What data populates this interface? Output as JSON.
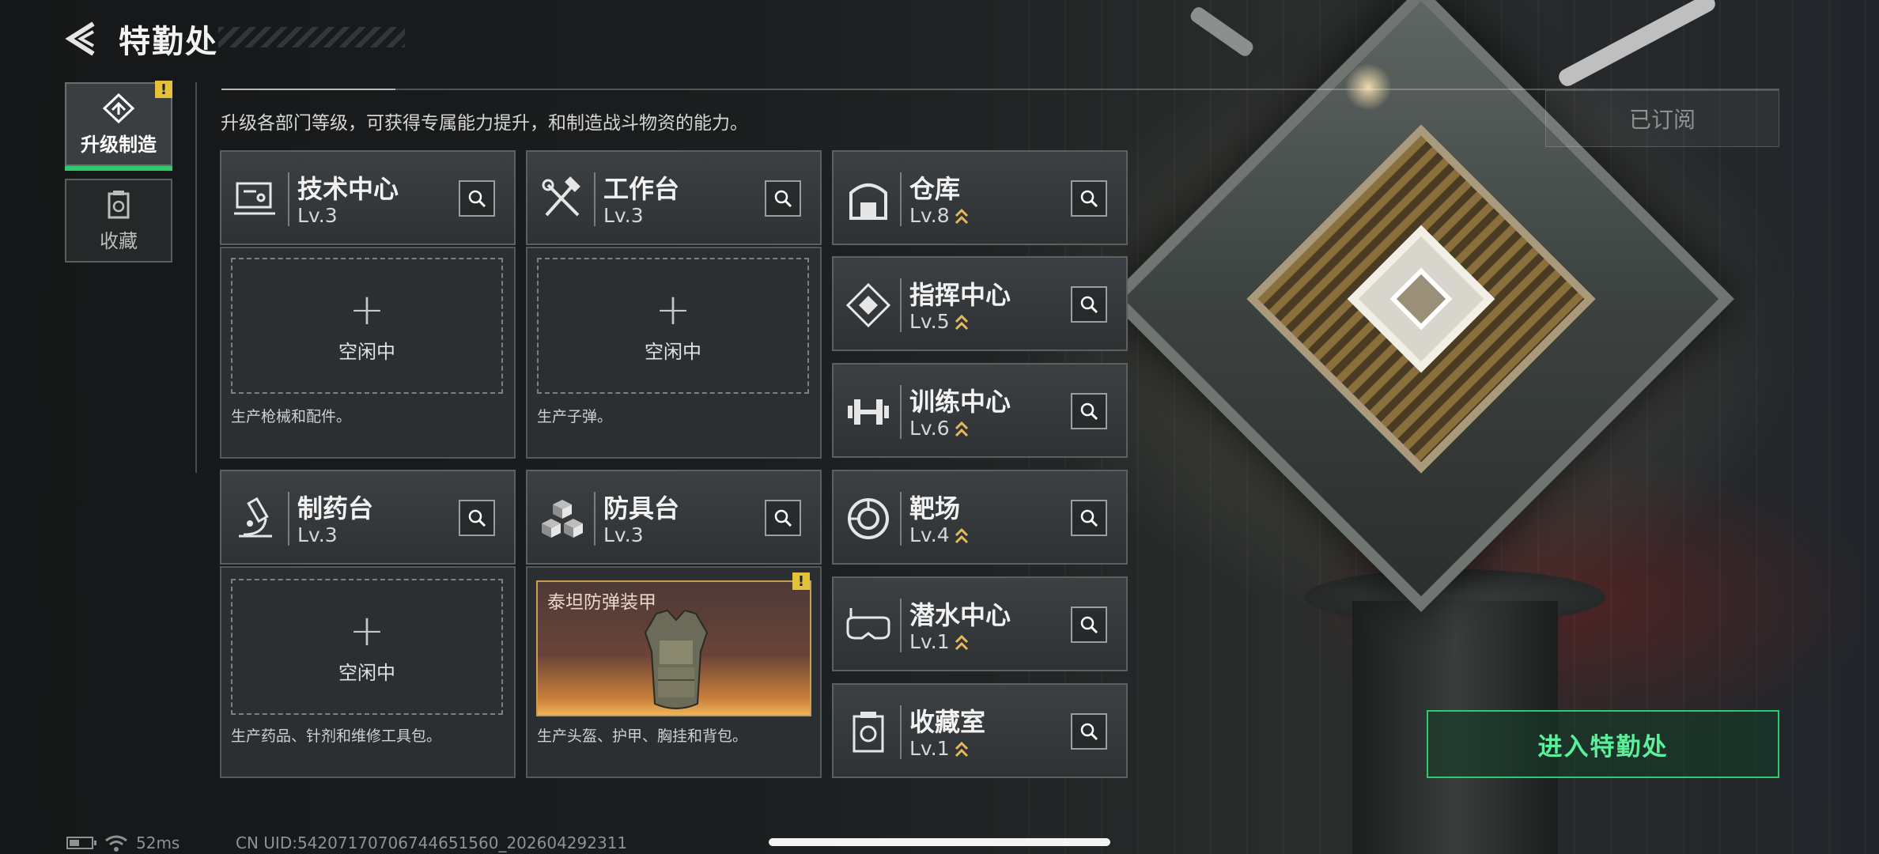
{
  "header": {
    "title": "特勤处",
    "subtitle": "升级各部门等级，可获得专属能力提升，和制造战斗物资的能力。",
    "subscribed_label": "已订阅"
  },
  "tabs": [
    {
      "label": "升级制造",
      "icon": "upgrade-icon",
      "active": true,
      "alert": "!"
    },
    {
      "label": "收藏",
      "icon": "collection-icon",
      "active": false
    }
  ],
  "production": [
    {
      "name": "技术中心",
      "level": "Lv.3",
      "icon": "circuit-icon",
      "slot": "空闲中",
      "desc": "生产枪械和配件。"
    },
    {
      "name": "工作台",
      "level": "Lv.3",
      "icon": "tools-icon",
      "slot": "空闲中",
      "desc": "生产子弹。"
    },
    {
      "name": "制药台",
      "level": "Lv.3",
      "icon": "microscope-icon",
      "slot": "空闲中",
      "desc": "生产药品、针剂和维修工具包。"
    },
    {
      "name": "防具台",
      "level": "Lv.3",
      "icon": "cubes-icon",
      "item": "泰坦防弹装甲",
      "alert": "!",
      "desc": "生产头盔、护甲、胸挂和背包。"
    }
  ],
  "facilities": [
    {
      "name": "仓库",
      "level": "Lv.8",
      "icon": "warehouse-icon",
      "upgradable": true
    },
    {
      "name": "指挥中心",
      "level": "Lv.5",
      "icon": "command-icon",
      "upgradable": true
    },
    {
      "name": "训练中心",
      "level": "Lv.6",
      "icon": "dumbbell-icon",
      "upgradable": true
    },
    {
      "name": "靶场",
      "level": "Lv.4",
      "icon": "target-icon",
      "upgradable": true
    },
    {
      "name": "潜水中心",
      "level": "Lv.1",
      "icon": "diving-mask-icon",
      "upgradable": true
    },
    {
      "name": "收藏室",
      "level": "Lv.1",
      "icon": "collection-room-icon",
      "upgradable": true
    }
  ],
  "enter_button": "进入特勤处",
  "status": {
    "ping": "52ms",
    "uid": "CN UID:5420717070674465156​0_202604292311"
  },
  "colors": {
    "accent_green": "#2ecb6c",
    "alert_yellow": "#e3c23a",
    "upgrade_gold": "#e7b95a"
  }
}
